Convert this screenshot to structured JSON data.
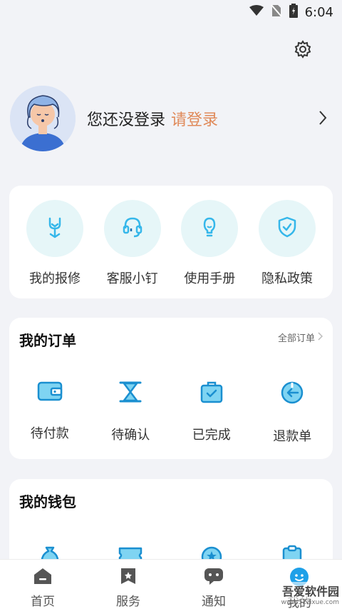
{
  "status_bar": {
    "time": "6:04"
  },
  "profile": {
    "not_logged_in": "您还没登录",
    "login_link": "请登录"
  },
  "tools": [
    {
      "label": "我的报修",
      "icon": "wrench-icon"
    },
    {
      "label": "客服小钉",
      "icon": "headset-icon"
    },
    {
      "label": "使用手册",
      "icon": "lightbulb-icon"
    },
    {
      "label": "隐私政策",
      "icon": "shield-check-icon"
    }
  ],
  "orders": {
    "title": "我的订单",
    "all_label": "全部订单",
    "items": [
      {
        "label": "待付款",
        "icon": "wallet-icon"
      },
      {
        "label": "待确认",
        "icon": "hourglass-icon"
      },
      {
        "label": "已完成",
        "icon": "briefcase-check-icon"
      },
      {
        "label": "退款单",
        "icon": "refund-icon"
      }
    ]
  },
  "wallet": {
    "title": "我的钱包"
  },
  "tabbar": {
    "items": [
      {
        "label": "首页",
        "icon": "home-icon"
      },
      {
        "label": "服务",
        "icon": "service-icon"
      },
      {
        "label": "通知",
        "icon": "chat-icon"
      },
      {
        "label": "我的",
        "icon": "user-icon"
      }
    ]
  },
  "watermark": {
    "text": "吾爱软件园",
    "url": "www.52zixue.com"
  },
  "colors": {
    "accent": "#1ea0e8",
    "link": "#e08a5a",
    "tool_bg": "#e6f6f8"
  }
}
